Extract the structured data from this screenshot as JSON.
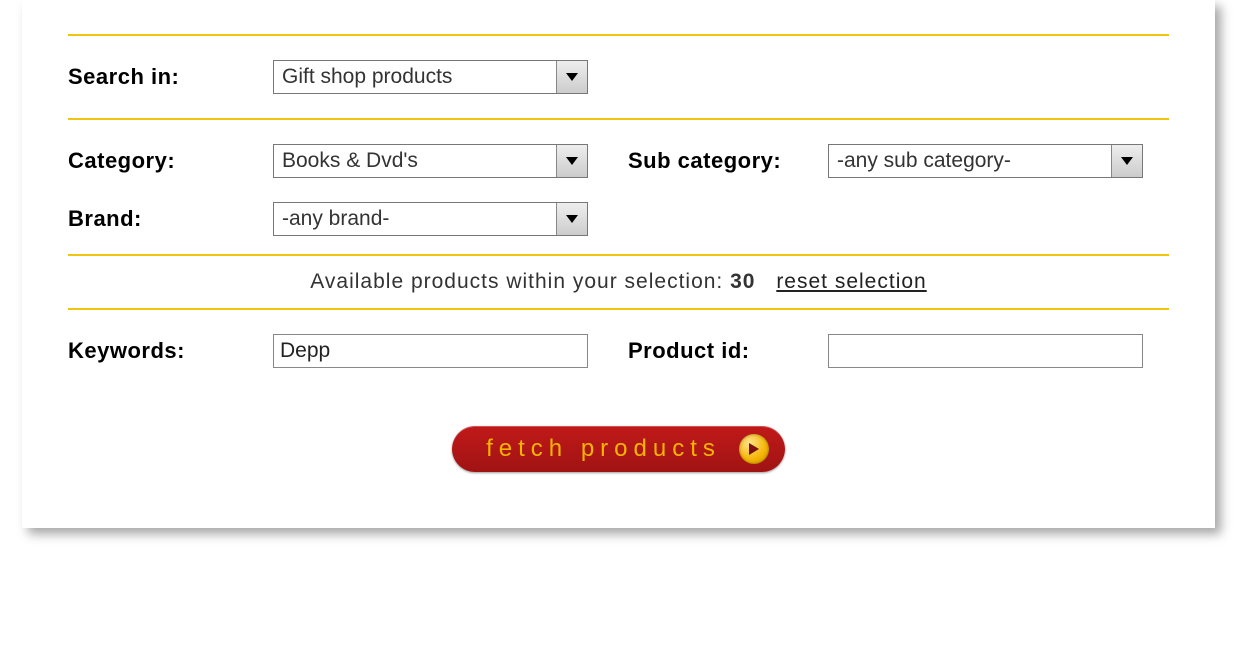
{
  "labels": {
    "search_in": "Search in:",
    "category": "Category:",
    "sub_category": "Sub category:",
    "brand": "Brand:",
    "keywords": "Keywords:",
    "product_id": "Product id:"
  },
  "selects": {
    "search_in": {
      "value": "Gift shop products"
    },
    "category": {
      "value": "Books & Dvd's"
    },
    "sub_category": {
      "value": "-any sub category-"
    },
    "brand": {
      "value": "-any brand-"
    }
  },
  "inputs": {
    "keywords": "Depp",
    "product_id": ""
  },
  "status": {
    "prefix": "Available products within your selection: ",
    "count": "30",
    "reset_label": "reset selection"
  },
  "buttons": {
    "fetch": "fetch products"
  }
}
